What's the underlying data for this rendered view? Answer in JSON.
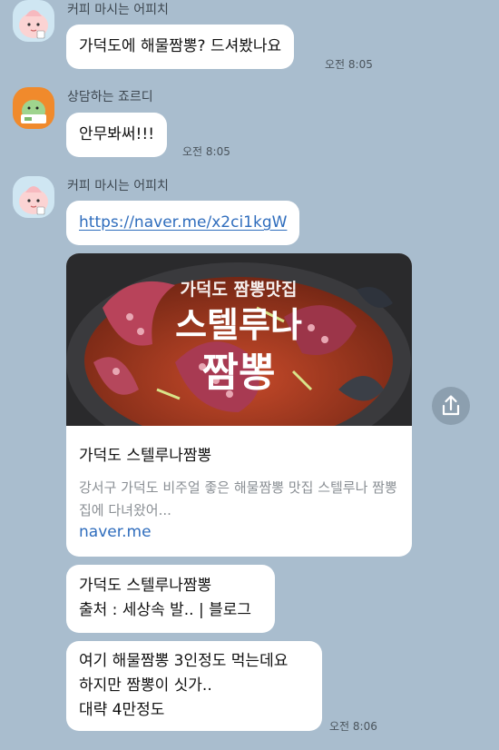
{
  "messages": [
    {
      "sender": "커피 마시는 어피치",
      "avatar_icon": "apeach-character-icon",
      "bubbles": [
        {
          "text": "가덕도에 해물짬뽕? 드셔봤나요",
          "time": "오전 8:05"
        }
      ]
    },
    {
      "sender": "상담하는 죠르디",
      "avatar_icon": "jordy-character-icon",
      "bubbles": [
        {
          "text": "안무봐써!!!",
          "time": "오전 8:05"
        }
      ]
    },
    {
      "sender": "커피 마시는 어피치",
      "avatar_icon": "apeach-character-icon",
      "link": "https://naver.me/x2ci1kgW",
      "card": {
        "image_caption": "가덕도 짬뽕맛집",
        "image_title_line1": "스텔루나",
        "image_title_line2": "짬뽕",
        "title": "가덕도 스텔루나짬뽕",
        "description": "강서구 가덕도 비주얼 좋은 해물짬뽕 맛집 스텔루나 짬뽕집에 다녀왔어...",
        "domain": "naver.me"
      },
      "source_bubble": {
        "line1": "가덕도 스텔루나짬뽕",
        "line2": "출처 : 세상속 발.. | 블로그"
      },
      "last_bubble": {
        "line1": "여기 해물짬뽕 3인정도 먹는데요",
        "line2": "하지만 짬뽕이 싯가..",
        "line3": "대략 4만정도",
        "time": "오전 8:06"
      }
    }
  ],
  "colors": {
    "background": "#a9bdce",
    "bubble": "#ffffff",
    "link": "#2f6dbd"
  },
  "icons": {
    "share": "share-icon"
  }
}
